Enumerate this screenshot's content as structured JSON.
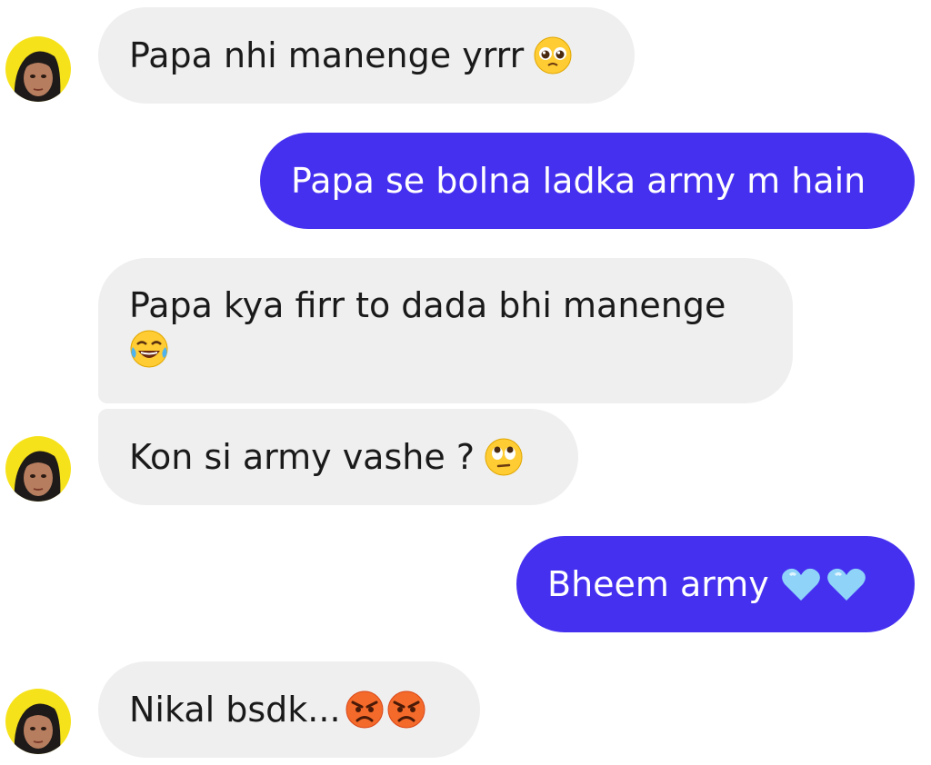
{
  "messages": [
    {
      "sender": "them",
      "text": "Papa nhi manenge yrrr",
      "emojis": [
        "pleading-face-emoji"
      ]
    },
    {
      "sender": "me",
      "text": "Papa se bolna ladka army m hain",
      "emojis": []
    },
    {
      "sender": "them",
      "text": "Papa kya firr to dada bhi manenge",
      "emojis": [
        "joy-emoji"
      ]
    },
    {
      "sender": "them",
      "text": "Kon si army vashe ?",
      "emojis": [
        "eye-roll-emoji"
      ]
    },
    {
      "sender": "me",
      "text": "Bheem army",
      "emojis": [
        "blue-heart-emoji",
        "blue-heart-emoji"
      ]
    },
    {
      "sender": "them",
      "text": "Nikal bsdk...",
      "emojis": [
        "angry-face-emoji",
        "angry-face-emoji"
      ]
    }
  ],
  "colors": {
    "incoming_bubble": "#efefef",
    "outgoing_bubble": "#4530f0",
    "incoming_text": "#1a1a1a",
    "outgoing_text": "#ffffff"
  },
  "icons": {
    "avatar": "contact-avatar",
    "pleading": "pleading-face-emoji",
    "joy": "joy-emoji",
    "eye_roll": "eye-roll-emoji",
    "blue_heart": "blue-heart-emoji",
    "angry": "angry-face-emoji"
  }
}
